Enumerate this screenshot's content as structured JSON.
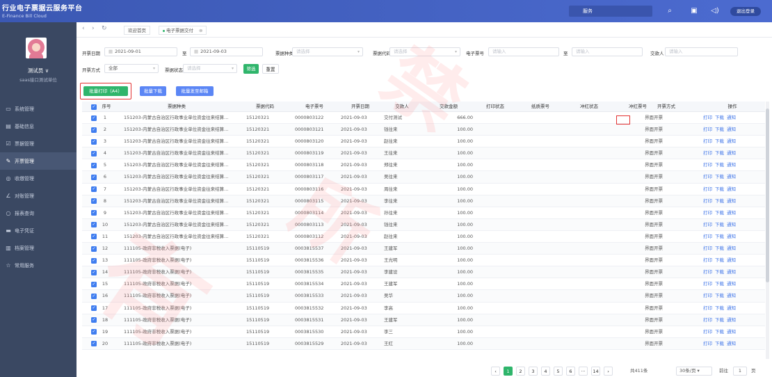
{
  "app": {
    "title": "行业电子票据云服务平台",
    "subtitle": "E-Finance Bill Cloud"
  },
  "topbar": {
    "service": "服务",
    "logout": "退出登录"
  },
  "user": {
    "name": "测试员 ∨",
    "org": "saas接口测试单位"
  },
  "sidebar": {
    "items": [
      {
        "label": "系统管理",
        "icon": "monitor-icon"
      },
      {
        "label": "基础信息",
        "icon": "info-icon"
      },
      {
        "label": "票据管理",
        "icon": "ticket-icon"
      },
      {
        "label": "开票管理",
        "icon": "edit-icon",
        "active": true
      },
      {
        "label": "收缴管理",
        "icon": "collect-icon"
      },
      {
        "label": "对账管理",
        "icon": "pen-icon"
      },
      {
        "label": "报表查询",
        "icon": "search-icon"
      },
      {
        "label": "电子凭证",
        "icon": "card-icon"
      },
      {
        "label": "档案管理",
        "icon": "archive-icon"
      },
      {
        "label": "常用服务",
        "icon": "star-icon"
      }
    ]
  },
  "tabs": {
    "home": "欢迎首页",
    "current": "电子票据交付"
  },
  "filters": {
    "issue_date_label": "开票日期",
    "date_from": "2021-09-01",
    "to_label": "至",
    "date_to": "2021-09-03",
    "bill_type_label": "票据种类",
    "bill_type_ph": "请选择",
    "bill_code_label": "票据代码",
    "bill_code_ph": "请选择",
    "bill_no_label": "电子票号",
    "bill_no_ph": "请输入",
    "to_label2": "至",
    "bill_no_to_ph": "请输入",
    "payer_label": "交款人",
    "payer_ph": "请输入",
    "method_label": "开票方式",
    "method_value": "全部",
    "status_label": "票据状态",
    "status_ph": "请选择",
    "filter_btn": "筛选",
    "reset_btn": "重置"
  },
  "actions": {
    "batch_print": "批量打印（A4）",
    "batch_download": "批量下载",
    "batch_email": "批量发至邮箱"
  },
  "table": {
    "headers": [
      "序号",
      "票据种类",
      "票据代码",
      "电子票号",
      "开票日期",
      "交款人",
      "交款金额",
      "打印状态",
      "纸质票号",
      "冲红状态",
      "冲红票号",
      "开票方式",
      "操作"
    ],
    "op_print": "打印",
    "op_download": "下载",
    "op_notify": "通知",
    "rows": [
      [
        "1",
        "151203-内蒙古自治区行政事业单位资金往来结算...",
        "15120321",
        "0000803122",
        "2021-09-03",
        "交付测试",
        "666.00",
        "界面开票"
      ],
      [
        "2",
        "151203-内蒙古自治区行政事业单位资金往来结算...",
        "15120321",
        "0000803121",
        "2021-09-03",
        "钱往来",
        "100.00",
        "界面开票"
      ],
      [
        "3",
        "151203-内蒙古自治区行政事业单位资金往来结算...",
        "15120321",
        "0000803120",
        "2021-09-03",
        "赵往来",
        "100.00",
        "界面开票"
      ],
      [
        "4",
        "151203-内蒙古自治区行政事业单位资金往来结算...",
        "15120321",
        "0000803119",
        "2021-09-03",
        "王往来",
        "100.00",
        "界面开票"
      ],
      [
        "5",
        "151203-内蒙古自治区行政事业单位资金往来结算...",
        "15120321",
        "0000803118",
        "2021-09-03",
        "郑往来",
        "100.00",
        "界面开票"
      ],
      [
        "6",
        "151203-内蒙古自治区行政事业单位资金往来结算...",
        "15120321",
        "0000803117",
        "2021-09-03",
        "吴往来",
        "100.00",
        "界面开票"
      ],
      [
        "7",
        "151203-内蒙古自治区行政事业单位资金往来结算...",
        "15120321",
        "0000803116",
        "2021-09-03",
        "周往来",
        "100.00",
        "界面开票"
      ],
      [
        "8",
        "151203-内蒙古自治区行政事业单位资金往来结算...",
        "15120321",
        "0000803115",
        "2021-09-03",
        "李往来",
        "100.00",
        "界面开票"
      ],
      [
        "9",
        "151203-内蒙古自治区行政事业单位资金往来结算...",
        "15120321",
        "0000803114",
        "2021-09-03",
        "孙往来",
        "100.00",
        "界面开票"
      ],
      [
        "10",
        "151203-内蒙古自治区行政事业单位资金往来结算...",
        "15120321",
        "0000803113",
        "2021-09-03",
        "钱往来",
        "100.00",
        "界面开票"
      ],
      [
        "11",
        "151203-内蒙古自治区行政事业单位资金往来结算...",
        "15120321",
        "0000803112",
        "2021-09-03",
        "赵往来",
        "100.00",
        "界面开票"
      ],
      [
        "12",
        "111105-政府非税收入票据(电子)",
        "15110519",
        "0003815537",
        "2021-09-03",
        "王建军",
        "100.00",
        "界面开票"
      ],
      [
        "13",
        "111105-政府非税收入票据(电子)",
        "15110519",
        "0003815536",
        "2021-09-03",
        "王光明",
        "100.00",
        "界面开票"
      ],
      [
        "14",
        "111105-政府非税收入票据(电子)",
        "15110519",
        "0003815535",
        "2021-09-03",
        "李建设",
        "100.00",
        "界面开票"
      ],
      [
        "15",
        "111105-政府非税收入票据(电子)",
        "15110519",
        "0003815534",
        "2021-09-03",
        "王建军",
        "100.00",
        "界面开票"
      ],
      [
        "16",
        "111105-政府非税收入票据(电子)",
        "15110519",
        "0003815533",
        "2021-09-03",
        "吴华",
        "100.00",
        "界面开票"
      ],
      [
        "17",
        "111105-政府非税收入票据(电子)",
        "15110519",
        "0003815532",
        "2021-09-03",
        "李高",
        "100.00",
        "界面开票"
      ],
      [
        "18",
        "111105-政府非税收入票据(电子)",
        "15110519",
        "0003815531",
        "2021-09-03",
        "王建军",
        "100.00",
        "界面开票"
      ],
      [
        "19",
        "111105-政府非税收入票据(电子)",
        "15110519",
        "0003815530",
        "2021-09-03",
        "李三",
        "100.00",
        "界面开票"
      ],
      [
        "20",
        "111105-政府非税收入票据(电子)",
        "15110519",
        "0003815529",
        "2021-09-03",
        "王红",
        "100.00",
        "界面开票"
      ]
    ]
  },
  "pagination": {
    "pages": [
      "1",
      "2",
      "3",
      "4",
      "5",
      "6",
      "···",
      "14"
    ],
    "total": "共411条",
    "per_page": "30条/页",
    "goto_label": "前往",
    "goto_value": "1",
    "page_unit": "页"
  },
  "watermark": "禁止外传"
}
